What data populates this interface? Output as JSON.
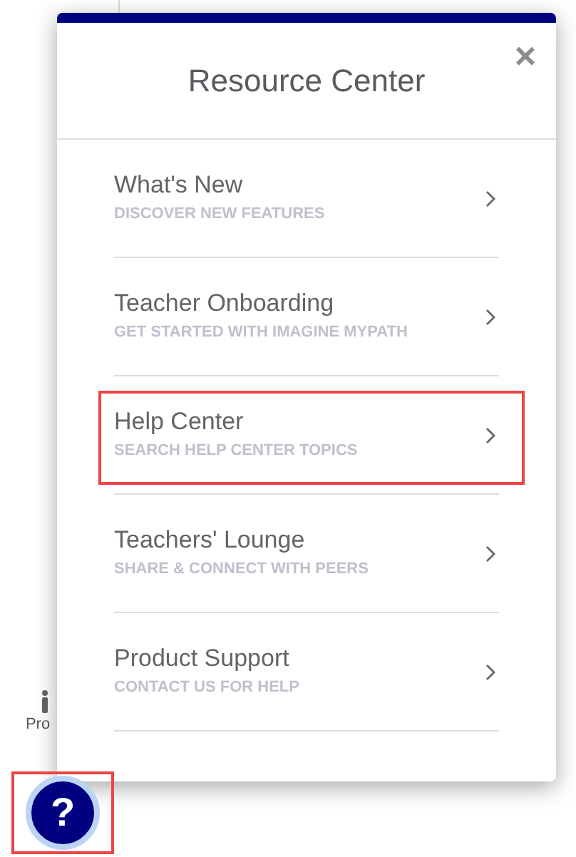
{
  "sidebar": {
    "items": [
      {
        "label": "Pro"
      }
    ]
  },
  "panel": {
    "title": "Resource Center",
    "close": "×",
    "items": [
      {
        "title": "What's New",
        "subtitle": "DISCOVER NEW FEATURES",
        "highlighted": false
      },
      {
        "title": "Teacher Onboarding",
        "subtitle": "GET STARTED WITH IMAGINE MYPATH",
        "highlighted": false
      },
      {
        "title": "Help Center",
        "subtitle": "SEARCH HELP CENTER TOPICS",
        "highlighted": true
      },
      {
        "title": "Teachers' Lounge",
        "subtitle": "SHARE & CONNECT WITH PEERS",
        "highlighted": false
      },
      {
        "title": "Product Support",
        "subtitle": "CONTACT US FOR HELP",
        "highlighted": false
      }
    ]
  },
  "help_button": {
    "label": "?",
    "highlighted": true
  }
}
